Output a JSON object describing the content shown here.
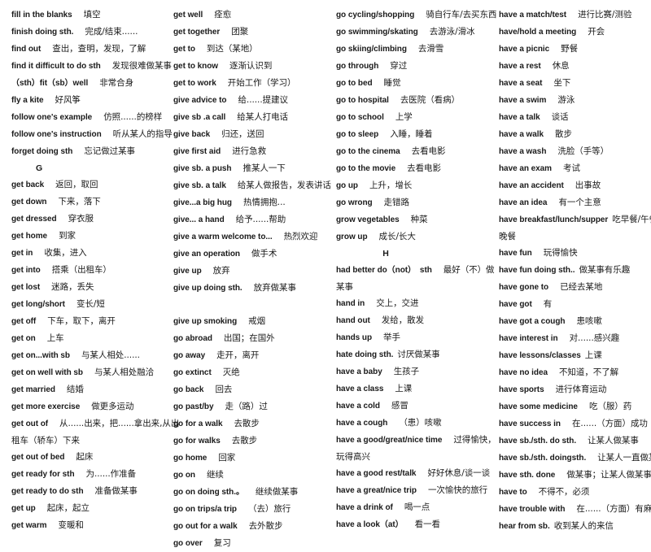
{
  "document": {
    "type": "vocabulary-phrase-list",
    "title_visible": false,
    "columns": [
      {
        "id": "column-1",
        "rows": [
          {
            "kind": "entry",
            "en": "fill in the blanks",
            "cn": "填空"
          },
          {
            "kind": "entry",
            "en": "finish doing sth.",
            "cn": "完成/结束......"
          },
          {
            "kind": "entry",
            "en": "find out",
            "cn": "查出，查明，发现，了解"
          },
          {
            "kind": "entry",
            "en": "find it difficult to do sth",
            "cn": "发现很难做某事"
          },
          {
            "kind": "entry",
            "en": "（sth）fit（sb）well",
            "cn": "非常合身"
          },
          {
            "kind": "entry",
            "en": "fly a kite",
            "cn": "好风筝"
          },
          {
            "kind": "entry",
            "en": "follow one's example",
            "cn": "仿照......的榜样"
          },
          {
            "kind": "entry",
            "en": "follow one's instruction",
            "cn": "听从某人的指导"
          },
          {
            "kind": "entry",
            "en": "forget doing sth",
            "cn": "忘记做过某事"
          },
          {
            "kind": "letter",
            "letter": "G"
          },
          {
            "kind": "entry",
            "en": "get back",
            "cn": "返回，取回"
          },
          {
            "kind": "entry",
            "en": "get down",
            "cn": "下来，落下"
          },
          {
            "kind": "entry",
            "en": "get dressed",
            "cn": "穿衣服"
          },
          {
            "kind": "entry",
            "en": "get home",
            "cn": "到家"
          },
          {
            "kind": "entry",
            "en": "get in",
            "cn": "收集，进入"
          },
          {
            "kind": "entry",
            "en": "get into",
            "cn": "搭乘（出租车）"
          },
          {
            "kind": "entry",
            "en": "get lost",
            "cn": "迷路，丢失"
          },
          {
            "kind": "entry",
            "en": "get long/short",
            "cn": "变长/短"
          },
          {
            "kind": "entry",
            "en": "get off",
            "cn": "下车，取下，离开"
          },
          {
            "kind": "entry",
            "en": "get on",
            "cn": "上车"
          },
          {
            "kind": "entry",
            "en": "get on...with sb",
            "cn": "与某人相处......"
          },
          {
            "kind": "entry",
            "en": "get on well with sb",
            "cn": "与某人相处融洽"
          },
          {
            "kind": "entry",
            "en": "get married",
            "cn": "结婚"
          },
          {
            "kind": "entry",
            "en": "get more exercise",
            "cn": "做更多运动"
          },
          {
            "kind": "entry",
            "en": "get out of",
            "cn": "从......出来，把......拿出来,从出"
          },
          {
            "kind": "continuation",
            "cn": "租车（轿车）下来"
          },
          {
            "kind": "entry",
            "en": "get out of bed",
            "cn": "起床"
          },
          {
            "kind": "entry",
            "en": "get ready for sth",
            "cn": "为......作准备"
          },
          {
            "kind": "entry",
            "en": "get ready to do sth",
            "cn": "准备做某事"
          },
          {
            "kind": "entry",
            "en": "get up",
            "cn": "起床，起立"
          },
          {
            "kind": "entry",
            "en": "get warm",
            "cn": "变暖和"
          }
        ]
      },
      {
        "id": "column-2",
        "rows": [
          {
            "kind": "entry",
            "en": "get well",
            "cn": "痊愈"
          },
          {
            "kind": "entry",
            "en": "get together",
            "cn": "团聚"
          },
          {
            "kind": "entry",
            "en": "get to",
            "cn": "到达（某地）"
          },
          {
            "kind": "entry",
            "en": "get to know",
            "cn": "逐渐认识到"
          },
          {
            "kind": "entry",
            "en": "get to work",
            "cn": "开始工作（学习）"
          },
          {
            "kind": "entry",
            "en": "give advice to",
            "cn": "给......提建议"
          },
          {
            "kind": "entry",
            "en": "give sb .a call",
            "cn": "给某人打电话"
          },
          {
            "kind": "entry",
            "en": "give back",
            "cn": "归还，送回"
          },
          {
            "kind": "entry",
            "en": "give first aid",
            "cn": "进行急救"
          },
          {
            "kind": "entry",
            "en": "give sb. a push",
            "cn": "推某人一下"
          },
          {
            "kind": "entry",
            "en": "give sb. a talk",
            "cn": "给某人做报告，发表讲话"
          },
          {
            "kind": "entry",
            "en": "give...a big hug",
            "cn": "热情拥抱..."
          },
          {
            "kind": "entry",
            "en": "give... a hand",
            "cn": "给予......帮助"
          },
          {
            "kind": "entry",
            "en": "give a warm welcome to...",
            "cn": "热烈欢迎"
          },
          {
            "kind": "entry",
            "en": "give an operation",
            "cn": "做手术"
          },
          {
            "kind": "entry",
            "en": "give up",
            "cn": "放弃"
          },
          {
            "kind": "entry",
            "en": "give up doing sth.",
            "cn": "放弃做某事"
          },
          {
            "kind": "blank"
          },
          {
            "kind": "entry",
            "en": "give up smoking",
            "cn": "戒烟"
          },
          {
            "kind": "entry",
            "en": "go abroad",
            "cn": "出国；在国外"
          },
          {
            "kind": "entry",
            "en": "go away",
            "cn": "走开，离开"
          },
          {
            "kind": "entry",
            "en": "go extinct",
            "cn": "灭绝"
          },
          {
            "kind": "entry",
            "en": "go back",
            "cn": "回去"
          },
          {
            "kind": "entry",
            "en": "go past/by",
            "cn": "走（路）过"
          },
          {
            "kind": "entry",
            "en": "go for a walk",
            "cn": "去散步"
          },
          {
            "kind": "entry",
            "en": "go for walks",
            "cn": "去散步"
          },
          {
            "kind": "entry",
            "en": "go home",
            "cn": "回家"
          },
          {
            "kind": "entry",
            "en": "go on",
            "cn": "继续"
          },
          {
            "kind": "entry",
            "en": "go on doing sth.。",
            "cn": "继续做某事"
          },
          {
            "kind": "entry",
            "en": "go on trips/a trip",
            "cn": "（去）旅行"
          },
          {
            "kind": "entry",
            "en": "go out for a walk",
            "cn": "去外散步"
          },
          {
            "kind": "entry",
            "en": "go over",
            "cn": "复习"
          }
        ]
      },
      {
        "id": "column-3",
        "rows": [
          {
            "kind": "entry",
            "en": "go cycling/shopping",
            "cn": "骑自行车/去买东西"
          },
          {
            "kind": "entry",
            "en": "go swimming/skating",
            "cn": "去游泳/滑冰"
          },
          {
            "kind": "entry",
            "en": "go skiing/climbing",
            "cn": "去滑雪"
          },
          {
            "kind": "entry",
            "en": "go through",
            "cn": "穿过"
          },
          {
            "kind": "entry",
            "en": "go to bed",
            "cn": "睡觉"
          },
          {
            "kind": "entry",
            "en": "go to hospital",
            "cn": "去医院（看病）"
          },
          {
            "kind": "entry",
            "en": "go to school",
            "cn": "上学"
          },
          {
            "kind": "entry",
            "en": "go to sleep",
            "cn": "入睡，睡着"
          },
          {
            "kind": "entry",
            "en": "go to the cinema",
            "cn": "去看电影"
          },
          {
            "kind": "entry",
            "en": "go to the movie",
            "cn": "去看电影"
          },
          {
            "kind": "entry",
            "en": "go up",
            "cn": "上升，增长"
          },
          {
            "kind": "entry",
            "en": "go wrong",
            "cn": "走错路"
          },
          {
            "kind": "entry",
            "en": "grow vegetables",
            "cn": "种菜"
          },
          {
            "kind": "entry",
            "en": "grow up",
            "cn": "成长/长大"
          },
          {
            "kind": "letter",
            "letter": "H",
            "centered": true
          },
          {
            "kind": "entry",
            "en": "had better do（not）　sth",
            "cn": "最好（不）做"
          },
          {
            "kind": "continuation",
            "cn": "某事"
          },
          {
            "kind": "entry",
            "en": "hand in",
            "cn": "交上，交进"
          },
          {
            "kind": "entry",
            "en": "hand out",
            "cn": "发给，散发"
          },
          {
            "kind": "entry",
            "en": "hands up",
            "cn": "举手"
          },
          {
            "kind": "entry",
            "en": "hate doing sth.",
            "cn": "讨厌做某事",
            "tight": true
          },
          {
            "kind": "entry",
            "en": "have a baby",
            "cn": "生孩子"
          },
          {
            "kind": "entry",
            "en": "have a class",
            "cn": "上课"
          },
          {
            "kind": "entry",
            "en": "have a cold",
            "cn": "感冒"
          },
          {
            "kind": "entry",
            "en": "have a cough",
            "cn": "（患）咳嗽"
          },
          {
            "kind": "entry",
            "en": "have a good/great/nice time",
            "cn": "过得愉快，"
          },
          {
            "kind": "continuation",
            "cn": "玩得高兴"
          },
          {
            "kind": "entry",
            "en": "have a good rest/talk",
            "cn": "好好休息/谈一谈"
          },
          {
            "kind": "entry",
            "en": "have a great/nice trip",
            "cn": "一次愉快的旅行"
          },
          {
            "kind": "entry",
            "en": "have a drink of",
            "cn": "喝一点"
          },
          {
            "kind": "entry",
            "en": "have a look（at）",
            "cn": "看一看"
          }
        ]
      },
      {
        "id": "column-4",
        "rows": [
          {
            "kind": "entry",
            "en": "have a match/test",
            "cn": "进行比赛/测验"
          },
          {
            "kind": "entry",
            "en": "have/hold a meeting",
            "cn": "开会"
          },
          {
            "kind": "entry",
            "en": "have a picnic",
            "cn": "野餐"
          },
          {
            "kind": "entry",
            "en": "have a rest",
            "cn": "休息"
          },
          {
            "kind": "entry",
            "en": "have a seat",
            "cn": "坐下"
          },
          {
            "kind": "entry",
            "en": "have a swim",
            "cn": "游泳"
          },
          {
            "kind": "entry",
            "en": "have a talk",
            "cn": "谈话"
          },
          {
            "kind": "entry",
            "en": "have a walk",
            "cn": "散步"
          },
          {
            "kind": "entry",
            "en": "have a wash",
            "cn": "洗脸（手等）"
          },
          {
            "kind": "entry",
            "en": "have an exam",
            "cn": "考试"
          },
          {
            "kind": "entry",
            "en": "have an accident",
            "cn": "出事故"
          },
          {
            "kind": "entry",
            "en": "have an idea",
            "cn": "有一个主意"
          },
          {
            "kind": "entry",
            "en": "have breakfast/lunch/supper",
            "cn": "吃早餐/午餐/",
            "tight": true
          },
          {
            "kind": "continuation",
            "cn": "晚餐"
          },
          {
            "kind": "entry",
            "en": "have fun",
            "cn": "玩得愉快"
          },
          {
            "kind": "entry",
            "en": "have fun doing sth..",
            "cn": "做某事有乐趣",
            "tight": true
          },
          {
            "kind": "entry",
            "en": "have gone to",
            "cn": "已经去某地"
          },
          {
            "kind": "entry",
            "en": "have got",
            "cn": "有"
          },
          {
            "kind": "entry",
            "en": "have got a cough",
            "cn": "患咳嗽"
          },
          {
            "kind": "entry",
            "en": "have interest in",
            "cn": "对......感兴趣"
          },
          {
            "kind": "entry",
            "en": "have lessons/classes",
            "cn": "上课",
            "tight": true
          },
          {
            "kind": "entry",
            "en": "have no idea",
            "cn": "不知道，不了解"
          },
          {
            "kind": "entry",
            "en": "have sports",
            "cn": "进行体育运动"
          },
          {
            "kind": "entry",
            "en": "have some medicine",
            "cn": "吃（服）药"
          },
          {
            "kind": "entry",
            "en": "have success in",
            "cn": "在......（方面）成功"
          },
          {
            "kind": "entry",
            "en": "have sb./sth. do sth.",
            "cn": "让某人做某事"
          },
          {
            "kind": "entry",
            "en": "have sb./sth. doingsth.",
            "cn": "让某人一直做某事"
          },
          {
            "kind": "entry",
            "en": "have sth. done",
            "cn": "做某事；让某人做某事"
          },
          {
            "kind": "entry",
            "en": "have to",
            "cn": "不得不，必须"
          },
          {
            "kind": "entry",
            "en": "have trouble with",
            "cn": "在......（方面）有麻烦"
          },
          {
            "kind": "entry",
            "en": "hear from sb.",
            "cn": "收到某人的来信",
            "tight": true
          }
        ]
      }
    ]
  }
}
